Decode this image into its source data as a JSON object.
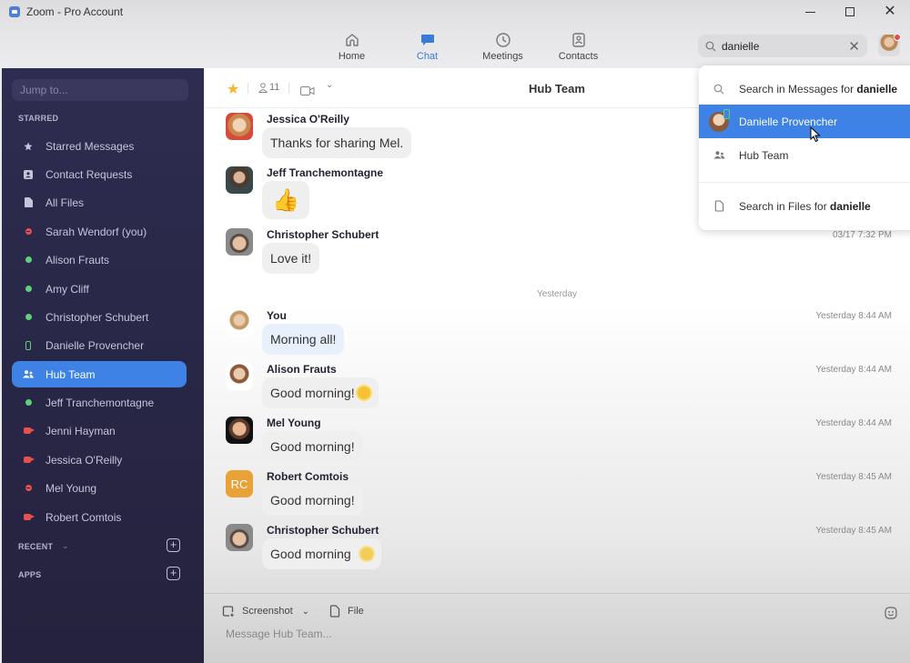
{
  "window": {
    "title": "Zoom - Pro Account",
    "controls": [
      "minimize",
      "maximize",
      "close"
    ]
  },
  "topnav": {
    "tabs": [
      {
        "label": "Home",
        "icon": "home-icon",
        "active": false
      },
      {
        "label": "Chat",
        "icon": "chat-icon",
        "active": true
      },
      {
        "label": "Meetings",
        "icon": "clock-icon",
        "active": false
      },
      {
        "label": "Contacts",
        "icon": "contact-card-icon",
        "active": false
      }
    ],
    "search": {
      "value": "danielle",
      "icon": "search-icon"
    },
    "accent_color": "#3a7bd5"
  },
  "sidebar": {
    "jump_placeholder": "Jump to...",
    "starred_label": "STARRED",
    "items": [
      {
        "label": "Starred Messages",
        "icon": "star-icon",
        "status": "none"
      },
      {
        "label": "Contact Requests",
        "icon": "contact-request-icon",
        "status": "none"
      },
      {
        "label": "All Files",
        "icon": "file-icon",
        "status": "none"
      },
      {
        "label": "Sarah Wendorf (you)",
        "icon": "do-not-disturb-icon",
        "status": "dnd"
      },
      {
        "label": "Alison Frauts",
        "icon": "online-dot-icon",
        "status": "online"
      },
      {
        "label": "Amy Cliff",
        "icon": "online-dot-icon",
        "status": "online"
      },
      {
        "label": "Christopher Schubert",
        "icon": "online-dot-icon",
        "status": "online"
      },
      {
        "label": "Danielle Provencher",
        "icon": "mobile-icon",
        "status": "mobile"
      },
      {
        "label": "Hub Team",
        "icon": "group-icon",
        "status": "channel",
        "active": true
      },
      {
        "label": "Jeff Tranchemontagne",
        "icon": "online-dot-icon",
        "status": "online"
      },
      {
        "label": "Jenni Hayman",
        "icon": "in-meeting-icon",
        "status": "in-meeting"
      },
      {
        "label": "Jessica O'Reilly",
        "icon": "in-meeting-icon",
        "status": "in-meeting"
      },
      {
        "label": "Mel Young",
        "icon": "do-not-disturb-icon",
        "status": "dnd"
      },
      {
        "label": "Robert Comtois",
        "icon": "in-meeting-icon",
        "status": "in-meeting"
      }
    ],
    "recent_label": "RECENT",
    "apps_label": "APPS",
    "colors": {
      "online": "#5fd07a",
      "busy": "#e85050",
      "active": "#3d82e4"
    }
  },
  "chat": {
    "title": "Hub Team",
    "member_count": "11",
    "starred": true,
    "date_divider": "Yesterday",
    "messages": [
      {
        "sender": "Jessica O'Reilly",
        "text": "Thanks for sharing Mel.",
        "time": ""
      },
      {
        "sender": "Jeff Tranchemontagne",
        "text": "👍",
        "time": ""
      },
      {
        "sender": "Christopher Schubert",
        "text": "Love it!",
        "time": "03/17 7:32 PM"
      },
      {
        "sender": "You",
        "text": "Morning all!",
        "time": "Yesterday 8:44 AM"
      },
      {
        "sender": "Alison Frauts",
        "text": "Good morning!",
        "time": "Yesterday 8:44 AM",
        "emoji": "sun-icon"
      },
      {
        "sender": "Mel Young",
        "text": "Good morning!",
        "time": "Yesterday 8:44 AM"
      },
      {
        "sender": "Robert Comtois",
        "text": "Good morning!",
        "time": "Yesterday 8:45 AM",
        "initials": "RC"
      },
      {
        "sender": "Christopher Schubert",
        "text": "Good morning",
        "time": "Yesterday 8:45 AM",
        "emoji": "sun-face-icon"
      }
    ],
    "composer": {
      "screenshot_label": "Screenshot",
      "file_label": "File",
      "placeholder": "Message Hub Team..."
    }
  },
  "search_dropdown": {
    "messages_prefix": "Search in Messages for ",
    "query": "danielle",
    "results": [
      {
        "label": "Danielle Provencher",
        "type": "contact",
        "selected": true
      },
      {
        "label": "Hub Team",
        "type": "channel",
        "selected": false
      }
    ],
    "files_prefix": "Search in Files for "
  }
}
